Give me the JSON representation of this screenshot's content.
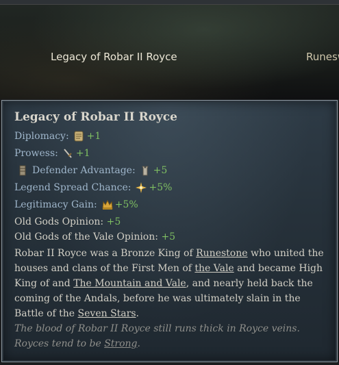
{
  "header": {
    "tab_active": "Legacy of Robar II Royce",
    "tab_next": "Runesw"
  },
  "tooltip": {
    "title": "Legacy of Robar II Royce",
    "modifiers": [
      {
        "label": "Diplomacy:",
        "icon": "scroll-icon",
        "value": "+1"
      },
      {
        "label": "Prowess:",
        "icon": "sword-icon",
        "value": "+1"
      },
      {
        "label": "Defender Advantage:",
        "icon": "tower-icon",
        "value": "+5"
      },
      {
        "label": "Legend Spread Chance:",
        "icon": "star-burst-icon",
        "value": "+5%"
      },
      {
        "label": "Legitimacy Gain:",
        "icon": "crown-icon",
        "value": "+5%"
      }
    ],
    "opinions": [
      {
        "label": "Old Gods Opinion:",
        "value": "+5"
      },
      {
        "label": "Old Gods of the Vale Opinion:",
        "value": "+5"
      }
    ],
    "description": {
      "p1": "Robar II Royce was a Bronze King of ",
      "link1": "Runestone",
      "p2": " who united the houses and clans of the First Men of ",
      "link2": "the Vale",
      "p3": " and became High King of  and ",
      "link3": "The Mountain and Vale",
      "p4": ", and nearly held back the coming of the Andals, before he was ultimately slain in the Battle of the ",
      "link4": "Seven Stars",
      "p5": "."
    },
    "flavor": {
      "p1": "The blood of Robar II Royce still runs thick in Royce veins. Royces tend to be ",
      "link": "Strong",
      "p2": "."
    }
  }
}
